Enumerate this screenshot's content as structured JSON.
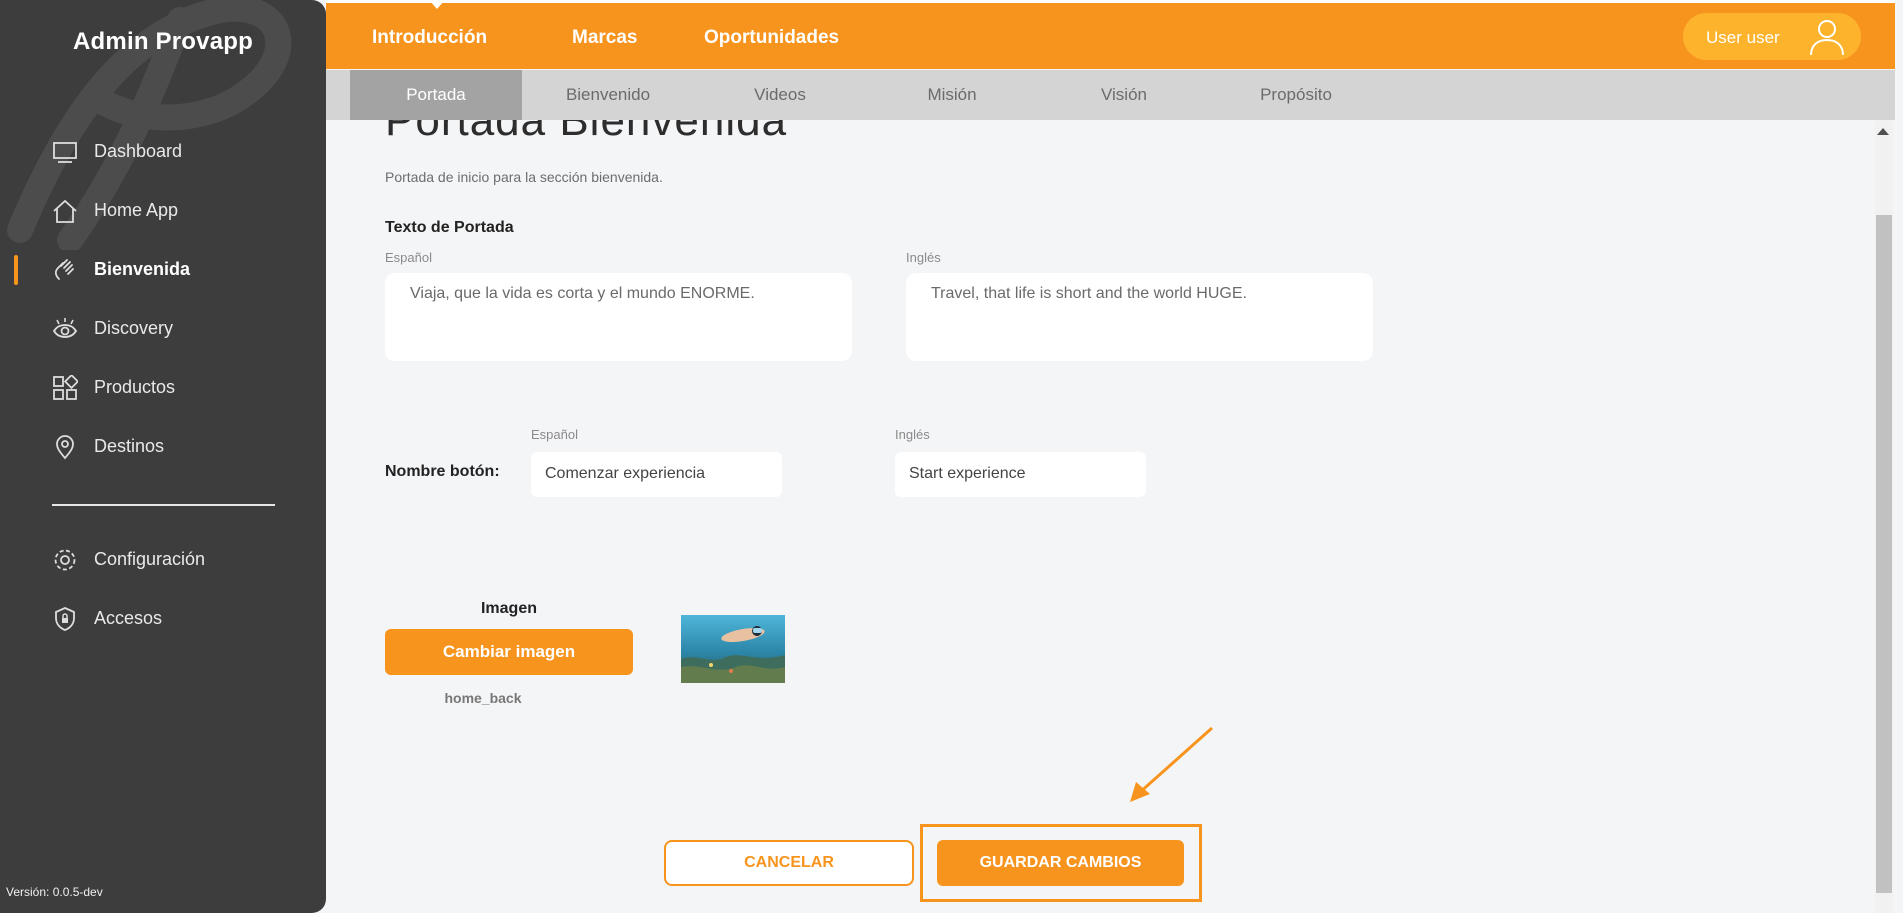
{
  "sidebar": {
    "brand": "Admin Provapp",
    "items": [
      {
        "label": "Dashboard",
        "icon": "monitor-icon"
      },
      {
        "label": "Home App",
        "icon": "home-icon"
      },
      {
        "label": "Bienvenida",
        "icon": "waving-hand-icon",
        "active": true
      },
      {
        "label": "Discovery",
        "icon": "eye-icon"
      },
      {
        "label": "Productos",
        "icon": "grid-icon"
      },
      {
        "label": "Destinos",
        "icon": "map-pin-icon"
      }
    ],
    "secondary_items": [
      {
        "label": "Configuración",
        "icon": "gear-icon"
      },
      {
        "label": "Accesos",
        "icon": "shield-lock-icon"
      }
    ],
    "version": "Versión: 0.0.5-dev"
  },
  "topbar": {
    "tabs": [
      {
        "label": "Introducción",
        "active": true
      },
      {
        "label": "Marcas"
      },
      {
        "label": "Oportunidades"
      }
    ],
    "user_name": "User user"
  },
  "subtabs": [
    {
      "label": "Portada",
      "active": true
    },
    {
      "label": "Bienvenido"
    },
    {
      "label": "Videos"
    },
    {
      "label": "Misión"
    },
    {
      "label": "Visión"
    },
    {
      "label": "Propósito"
    }
  ],
  "main": {
    "title": "Portada Bienvenida",
    "description": "Portada de inicio para la sección bienvenida.",
    "cover_text": {
      "section_label": "Texto de Portada",
      "es_label": "Español",
      "en_label": "Inglés",
      "es_value": "Viaja, que la vida es corta y el mundo ENORME.",
      "en_value": "Travel, that life is short and the world HUGE."
    },
    "button_name": {
      "section_label": "Nombre botón:",
      "es_label": "Español",
      "en_label": "Inglés",
      "es_value": "Comenzar experiencia",
      "en_value": "Start experience"
    },
    "image": {
      "label": "Imagen",
      "change_button": "Cambiar imagen",
      "filename": "home_back"
    },
    "actions": {
      "cancel": "CANCELAR",
      "save": "GUARDAR CAMBIOS"
    }
  },
  "colors": {
    "accent": "#f7941d",
    "sidebar_bg": "#3d3d3d",
    "content_bg": "#f4f5f7"
  }
}
